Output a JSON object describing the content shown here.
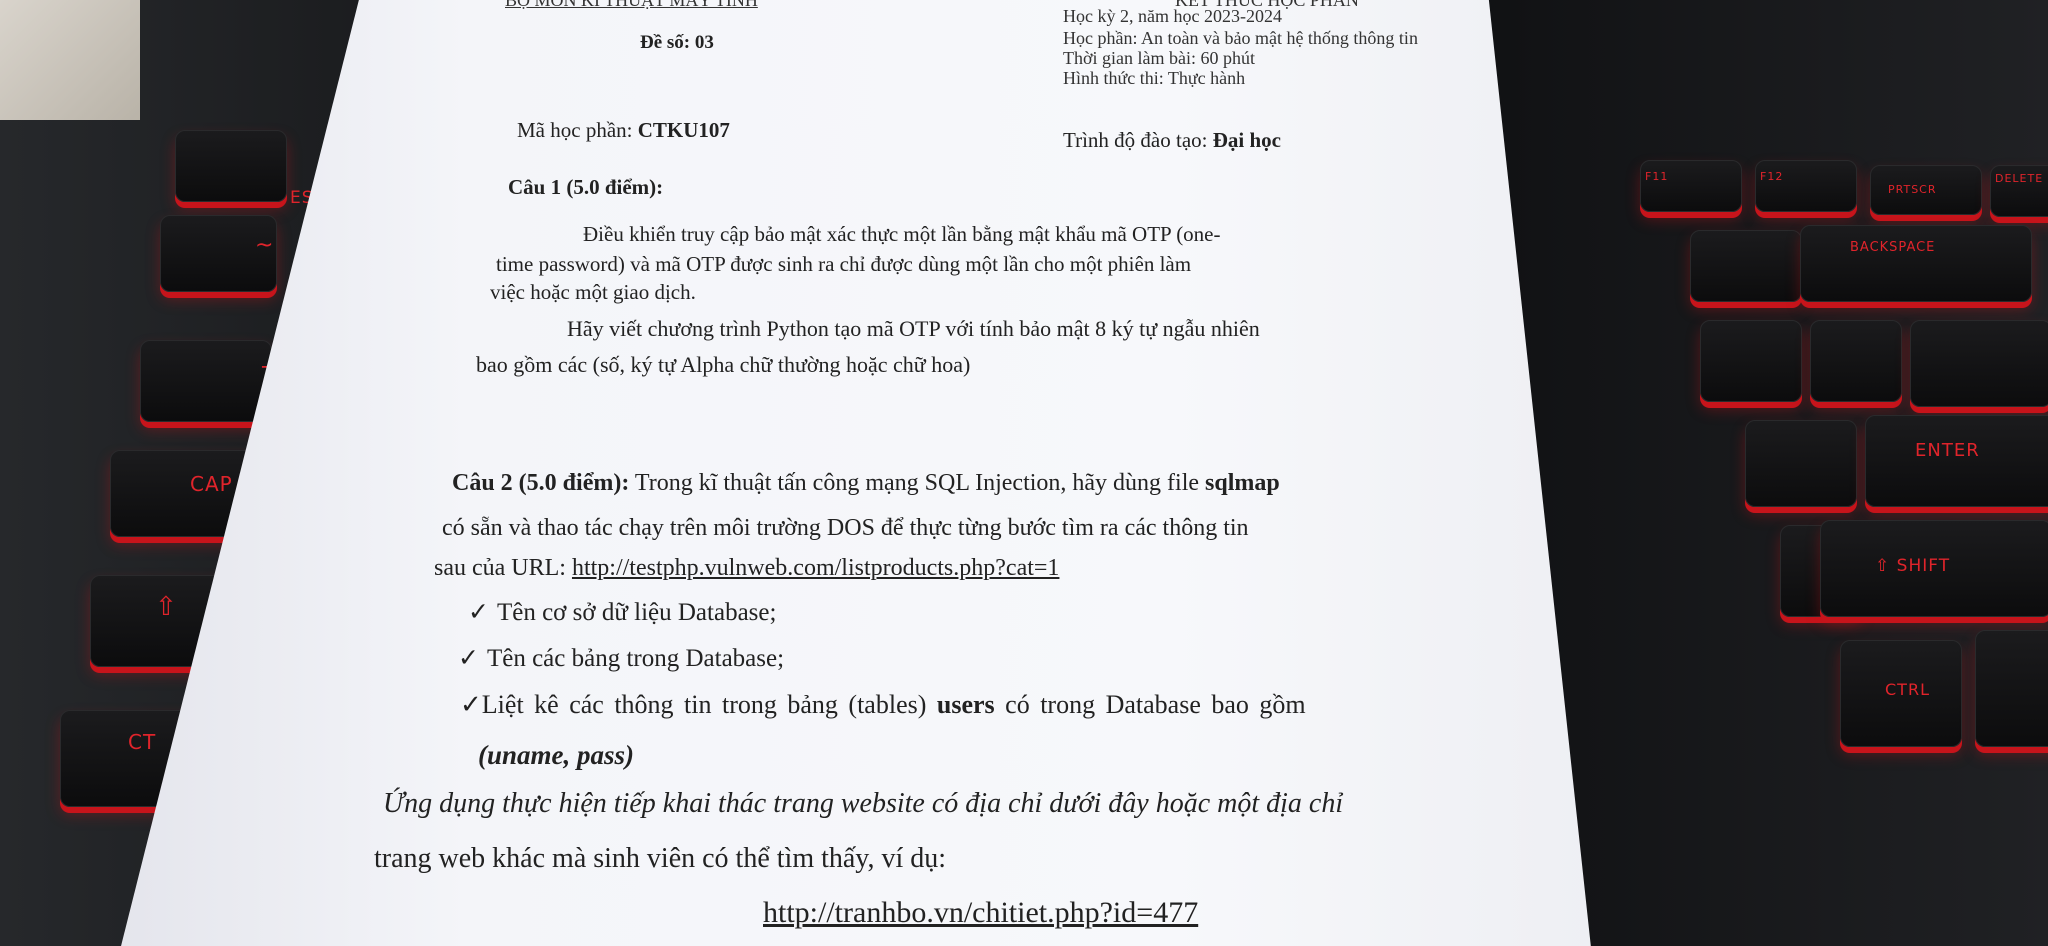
{
  "header": {
    "dept": "BỘ MÔN KĨ THUẬT MÁY TÍNH",
    "top_right_partial": "KẾT THÚC HỌC PHẦN",
    "exam_number_label": "Đề số: 03",
    "semester": "Học kỳ 2, năm học 2023-2024",
    "course": "Học phần: An toàn và bảo mật hệ thống thông tin",
    "duration": "Thời gian làm bài: 60 phút",
    "exam_form": "Hình thức thi: Thực hành",
    "course_code_label": "Mã học phần: ",
    "course_code": "CTKU107",
    "level_label": "Trình độ đào tạo: ",
    "level": "Đại học"
  },
  "q1": {
    "title": "Câu 1 (5.0 điểm):",
    "line1": "Điều khiển truy cập bảo mật xác thực một lần bằng mật khẩu mã OTP (one-",
    "line2": "time password) và mã OTP được sinh ra chỉ được dùng một lần cho một phiên làm",
    "line3": "việc hoặc một giao dịch.",
    "line4": "Hãy viết chương trình Python tạo mã OTP với tính bảo mật 8 ký tự ngẫu nhiên",
    "line5": "bao gồm các (số, ký tự Alpha chữ thường hoặc chữ hoa)"
  },
  "q2": {
    "title": "Câu 2 (5.0 điểm):",
    "line1_rest": " Trong kĩ thuật tấn công mạng SQL Injection, hãy dùng file ",
    "line1_bold": "sqlmap",
    "line2": "có sẵn và thao tác chạy trên môi trường DOS để thực từng bước tìm ra các thông tin",
    "line3_prefix": "sau của URL: ",
    "url1": "http://testphp.vulnweb.com/listproducts.php?cat=1",
    "check_mark": "✓",
    "bullet1": "Tên cơ sở dữ liệu Database;",
    "bullet2": "Tên các bảng trong Database;",
    "bullet3_a": "Liệt kê các thông tin trong bảng (tables) ",
    "bullet3_bold": "users",
    "bullet3_b": " có trong Database bao gồm",
    "bullet3_fields": "(uname, pass)",
    "app_line1": "Ứng dụng thực hiện tiếp khai thác trang website có địa chỉ dưới đây hoặc một địa chỉ",
    "app_line2": "trang web khác mà sinh viên có thể tìm thấy, ví dụ:",
    "url2": "http://tranhbo.vn/chitiet.php?id=477"
  },
  "keyboard": {
    "key_esc": "ES",
    "key_tilde": "~",
    "key_tab": "T",
    "key_caps": "CAP",
    "key_shift_left": "⇧",
    "key_ctrl_left": "CT",
    "key_f11": "F11",
    "key_f12": "F12",
    "key_prtsc": "PRTSCR",
    "key_delete": "DELETE",
    "key_backspace": "BACKSPACE",
    "key_enter": "ENTER",
    "key_shift_right": "⇧ SHIFT",
    "key_ctrl_right": "CTRL",
    "color_accent": "#e0242b"
  }
}
